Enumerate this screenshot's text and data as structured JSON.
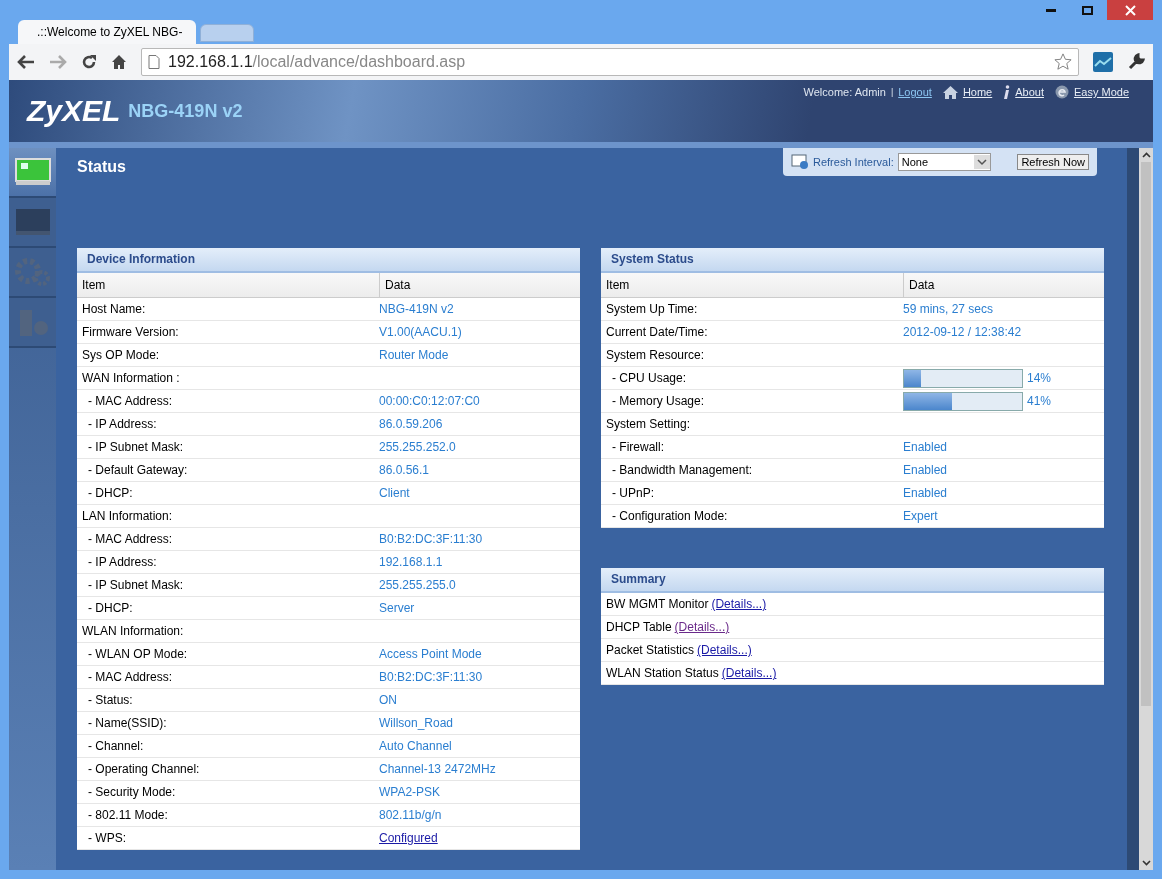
{
  "browser": {
    "tabs": [
      {
        "title": ".::Welcome to ZyXEL NBG-",
        "selected": true
      },
      {
        "selected": false
      }
    ],
    "address": {
      "host": "192.168.1.1",
      "path": "/local/advance/dashboard.asp"
    }
  },
  "header": {
    "brand": "ZyXEL",
    "model": "NBG-419N v2",
    "welcome": "Welcome: Admin",
    "separator": "|",
    "links": [
      {
        "label": "Logout",
        "kind": "plain"
      },
      {
        "label": "Home",
        "kind": "home"
      },
      {
        "label": "About",
        "kind": "about"
      },
      {
        "label": "Easy Mode",
        "kind": "easy"
      }
    ]
  },
  "sidebar": {
    "items": [
      {
        "kind": "status",
        "selected": true
      },
      {
        "kind": "monitor",
        "selected": false
      },
      {
        "kind": "config",
        "selected": false
      },
      {
        "kind": "maintenance",
        "selected": false
      }
    ]
  },
  "page_title": "Status",
  "refresh": {
    "label": "Refresh Interval:",
    "value": "None",
    "button": "Refresh Now"
  },
  "device_information": {
    "title": "Device Information",
    "columns": [
      "Item",
      "Data"
    ],
    "rows": [
      {
        "item": "Host Name:",
        "data": "NBG-419N v2",
        "kind": "value"
      },
      {
        "item": "Firmware Version:",
        "data": "V1.00(AACU.1)",
        "kind": "value"
      },
      {
        "item": "Sys OP Mode:",
        "data": "Router Mode",
        "kind": "value"
      },
      {
        "item": "WAN Information :",
        "kind": "section",
        "children": [
          {
            "item": "- MAC Address:",
            "data": "00:00:C0:12:07:C0",
            "kind": "value"
          },
          {
            "item": "- IP Address:",
            "data": "86.0.59.206",
            "kind": "value"
          },
          {
            "item": "- IP Subnet Mask:",
            "data": "255.255.252.0",
            "kind": "value"
          },
          {
            "item": "- Default Gateway:",
            "data": "86.0.56.1",
            "kind": "value"
          },
          {
            "item": "- DHCP:",
            "data": "Client",
            "kind": "value"
          }
        ]
      },
      {
        "item": "LAN Information:",
        "kind": "section",
        "children": [
          {
            "item": "- MAC Address:",
            "data": "B0:B2:DC:3F:11:30",
            "kind": "value"
          },
          {
            "item": "- IP Address:",
            "data": "192.168.1.1",
            "kind": "value"
          },
          {
            "item": "- IP Subnet Mask:",
            "data": "255.255.255.0",
            "kind": "value"
          },
          {
            "item": "- DHCP:",
            "data": "Server",
            "kind": "value"
          }
        ]
      },
      {
        "item": "WLAN Information:",
        "kind": "section",
        "children": [
          {
            "item": "- WLAN OP Mode:",
            "data": "Access Point Mode",
            "kind": "value"
          },
          {
            "item": "- MAC Address:",
            "data": "B0:B2:DC:3F:11:30",
            "kind": "value"
          },
          {
            "item": "- Status:",
            "data": "ON",
            "kind": "value"
          },
          {
            "item": "- Name(SSID):",
            "data": "Willson_Road",
            "kind": "value"
          },
          {
            "item": "- Channel:",
            "data": "Auto Channel",
            "kind": "value"
          },
          {
            "item": "- Operating Channel:",
            "data": "Channel-13 2472MHz",
            "kind": "value"
          },
          {
            "item": "- Security Mode:",
            "data": "WPA2-PSK",
            "kind": "value"
          },
          {
            "item": "- 802.11 Mode:",
            "data": "802.11b/g/n",
            "kind": "value"
          },
          {
            "item": "- WPS:",
            "data": "Configured",
            "kind": "link"
          }
        ]
      }
    ]
  },
  "system_status": {
    "title": "System Status",
    "columns": [
      "Item",
      "Data"
    ],
    "rows": [
      {
        "item": "System Up Time:",
        "data": "59 mins, 27 secs",
        "kind": "value"
      },
      {
        "item": "Current Date/Time:",
        "data": "2012-09-12 / 12:38:42",
        "kind": "value"
      },
      {
        "item": "System Resource:",
        "kind": "section",
        "children": [
          {
            "item": "- CPU Usage:",
            "kind": "meter",
            "level": 0.14,
            "data": "14%"
          },
          {
            "item": "- Memory Usage:",
            "kind": "meter",
            "level": 0.41,
            "data": "41%"
          }
        ]
      },
      {
        "item": "System Setting:",
        "kind": "section",
        "children": [
          {
            "item": "- Firewall:",
            "data": "Enabled",
            "kind": "value"
          },
          {
            "item": "- Bandwidth Management:",
            "data": "Enabled",
            "kind": "value"
          },
          {
            "item": "- UPnP:",
            "data": "Enabled",
            "kind": "value"
          },
          {
            "item": "- Configuration Mode:",
            "data": "Expert",
            "kind": "value"
          }
        ]
      }
    ]
  },
  "summary": {
    "title": "Summary",
    "items": [
      {
        "label": "BW MGMT Monitor",
        "link": "(Details...)",
        "visited": false
      },
      {
        "label": "DHCP Table",
        "link": "(Details...)",
        "visited": true
      },
      {
        "label": "Packet Statistics",
        "link": "(Details...)",
        "visited": false
      },
      {
        "label": "WLAN Station Status",
        "link": "(Details...)",
        "visited": false
      }
    ]
  }
}
